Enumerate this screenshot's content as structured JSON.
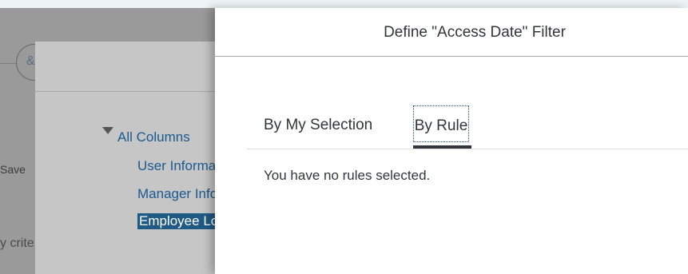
{
  "background": {
    "save_text": "Save",
    "criteria_text": "y crite",
    "user_glyph": "&",
    "tree": {
      "root_label": "All Columns",
      "children": [
        "User Informa",
        "Manager Info",
        "Employee Lo"
      ]
    }
  },
  "panel": {
    "title": "Define \"Access Date\" Filter",
    "tabs": [
      {
        "label": "By My Selection",
        "selected": false
      },
      {
        "label": "By Rule",
        "selected": true
      }
    ],
    "empty_message": "You have no rules selected."
  },
  "colors": {
    "link": "#1a5a8e",
    "selected_highlight": "#1f5a85",
    "text": "#32363a"
  }
}
